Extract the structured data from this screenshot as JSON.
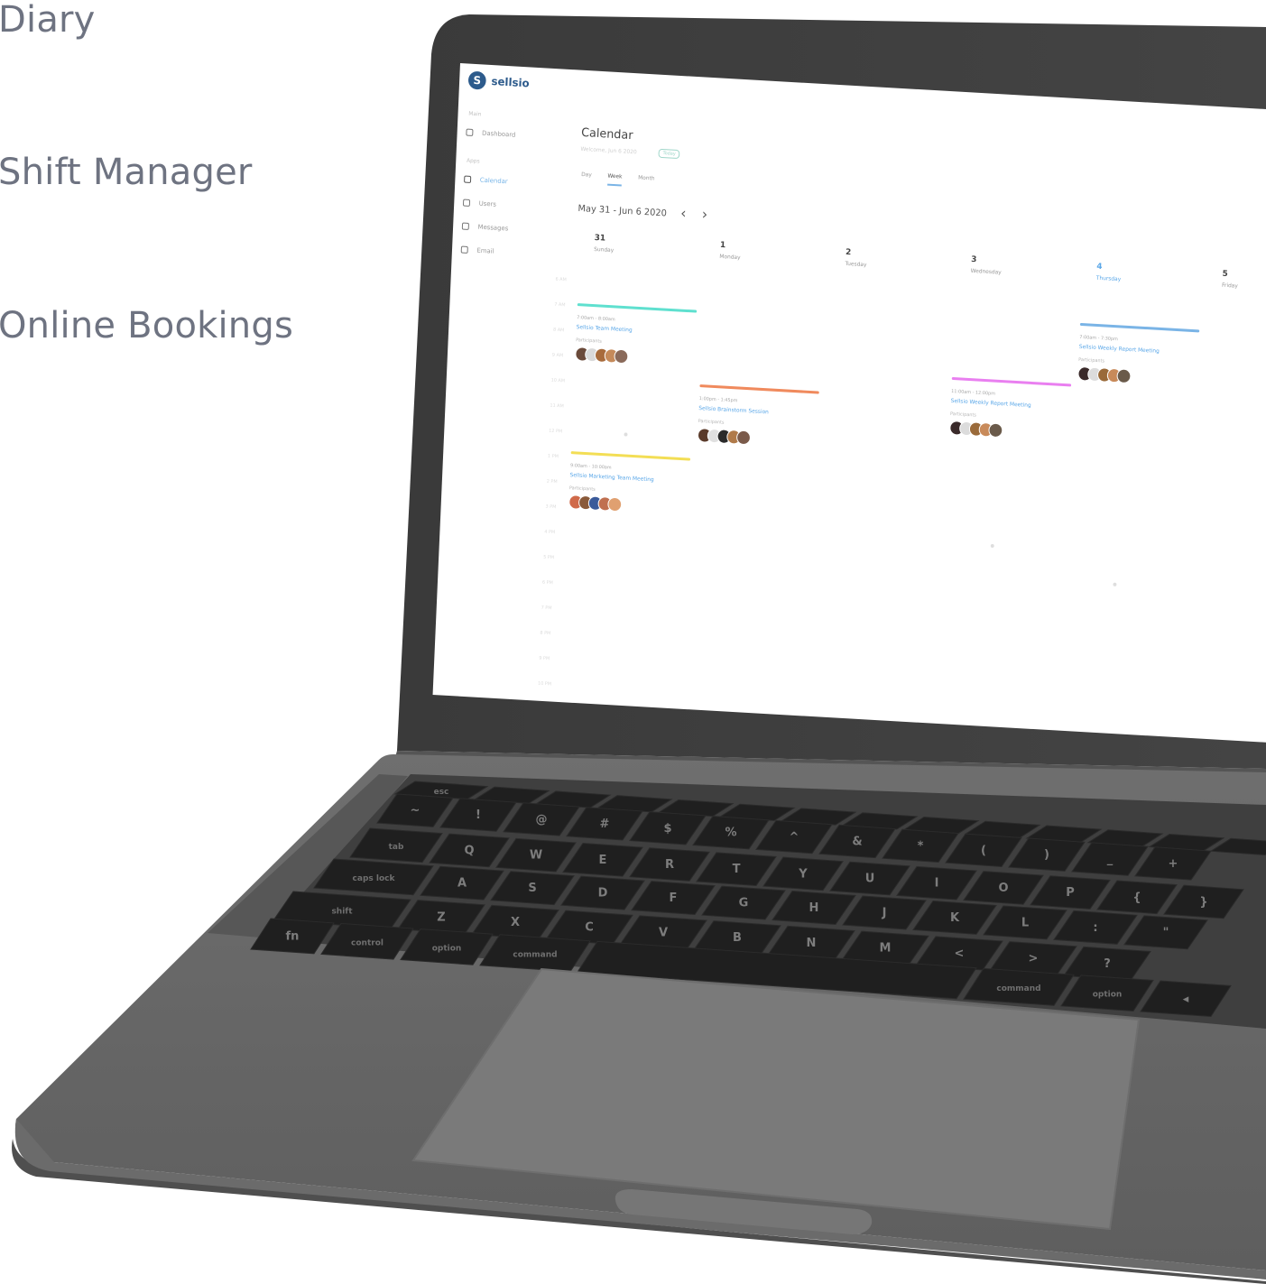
{
  "features": [
    "Diary",
    "Shift Manager",
    "Online Bookings"
  ],
  "app": {
    "logo_mark": "S",
    "name": "sellsio"
  },
  "sidebar": {
    "groups": [
      "Main",
      "Apps"
    ],
    "items": [
      {
        "label": "Dashboard",
        "icon": "home-icon"
      },
      {
        "label": "Calendar",
        "icon": "calendar-icon"
      },
      {
        "label": "Users",
        "icon": "users-icon"
      },
      {
        "label": "Messages",
        "icon": "chat-icon"
      },
      {
        "label": "Email",
        "icon": "mail-icon"
      }
    ]
  },
  "calendar": {
    "title": "Calendar",
    "subtitle": "Welcome, Jun 6 2020",
    "subtitle_badge": "Today",
    "tabs": [
      "Day",
      "Week",
      "Month"
    ],
    "active_tab": "Week",
    "range": "May 31 - Jun 6 2020",
    "days": [
      {
        "num": "31",
        "name": "Sunday"
      },
      {
        "num": "1",
        "name": "Monday"
      },
      {
        "num": "2",
        "name": "Tuesday"
      },
      {
        "num": "3",
        "name": "Wednesday"
      },
      {
        "num": "4",
        "name": "Thursday"
      },
      {
        "num": "5",
        "name": "Friday"
      }
    ],
    "today_index": 4,
    "times": [
      "6 AM",
      "7 AM",
      "8 AM",
      "9 AM",
      "10 AM",
      "11 AM",
      "12 PM",
      "1 PM",
      "2 PM",
      "3 PM",
      "4 PM",
      "5 PM",
      "6 PM",
      "7 PM",
      "8 PM",
      "9 PM",
      "10 PM",
      "11 PM"
    ],
    "events": [
      {
        "day": 0,
        "color": "#5fe0cf",
        "time": "7:00am - 8:00am",
        "title": "Sellsio Team Meeting",
        "participants_label": "Participants",
        "avatars": [
          "#6a4a3a",
          "#d9d9d9",
          "#a86b3c",
          "#c58a5a",
          "#8a6a5a"
        ]
      },
      {
        "day": 1,
        "color": "#f08a5d",
        "time": "1:00pm - 1:45pm",
        "title": "Sellsio Brainstorm Session",
        "participants_label": "Participants",
        "avatars": [
          "#5a3a2a",
          "#e0e0e0",
          "#2a2a2a",
          "#b07a4a",
          "#7a5a4a"
        ]
      },
      {
        "day": 3,
        "color": "#e97ff0",
        "time": "11:00am - 12:00pm",
        "title": "Sellsio Weekly Report Meeting",
        "participants_label": "Participants",
        "avatars": [
          "#3a2a2a",
          "#dcdcdc",
          "#9a6a3a",
          "#c88a5a",
          "#6a5a4a"
        ]
      },
      {
        "day": 4,
        "color": "#7ab4e6",
        "time": "7:00am - 7:30pm",
        "title": "Sellsio Weekly Report Meeting",
        "participants_label": "Participants",
        "avatars": [
          "#3a2a2a",
          "#dcdcdc",
          "#9a6a3a",
          "#c88a5a",
          "#6a5a4a"
        ]
      },
      {
        "day": 0,
        "color": "#f3de55",
        "time": "9:00am - 10:00am",
        "title": "Sellsio Marketing Team Meeting",
        "participants_label": "Participants",
        "avatars": [
          "#d06a4a",
          "#8a5a3a",
          "#3a5a9a",
          "#c07050",
          "#e0a070"
        ]
      }
    ]
  },
  "keyboard": {
    "rows": [
      [
        "esc",
        "",
        "",
        "",
        "",
        "",
        "",
        "",
        "",
        "",
        "",
        "",
        "",
        ""
      ],
      [
        "~",
        "!",
        "@",
        "#",
        "$",
        "%",
        "^",
        "&",
        "*",
        "(",
        ")",
        "_",
        "+"
      ],
      [
        "tab",
        "Q",
        "W",
        "E",
        "R",
        "T",
        "Y",
        "U",
        "I",
        "O",
        "P",
        "{",
        "}"
      ],
      [
        "caps lock",
        "A",
        "S",
        "D",
        "F",
        "G",
        "H",
        "J",
        "K",
        "L",
        ":",
        "\""
      ],
      [
        "shift",
        "Z",
        "X",
        "C",
        "V",
        "B",
        "N",
        "M",
        "<",
        ">",
        "?"
      ],
      [
        "fn",
        "control",
        "option",
        "command",
        "",
        "command",
        "option",
        "◂"
      ]
    ],
    "command_symbol": "⌘",
    "option_symbol": "⌥"
  }
}
